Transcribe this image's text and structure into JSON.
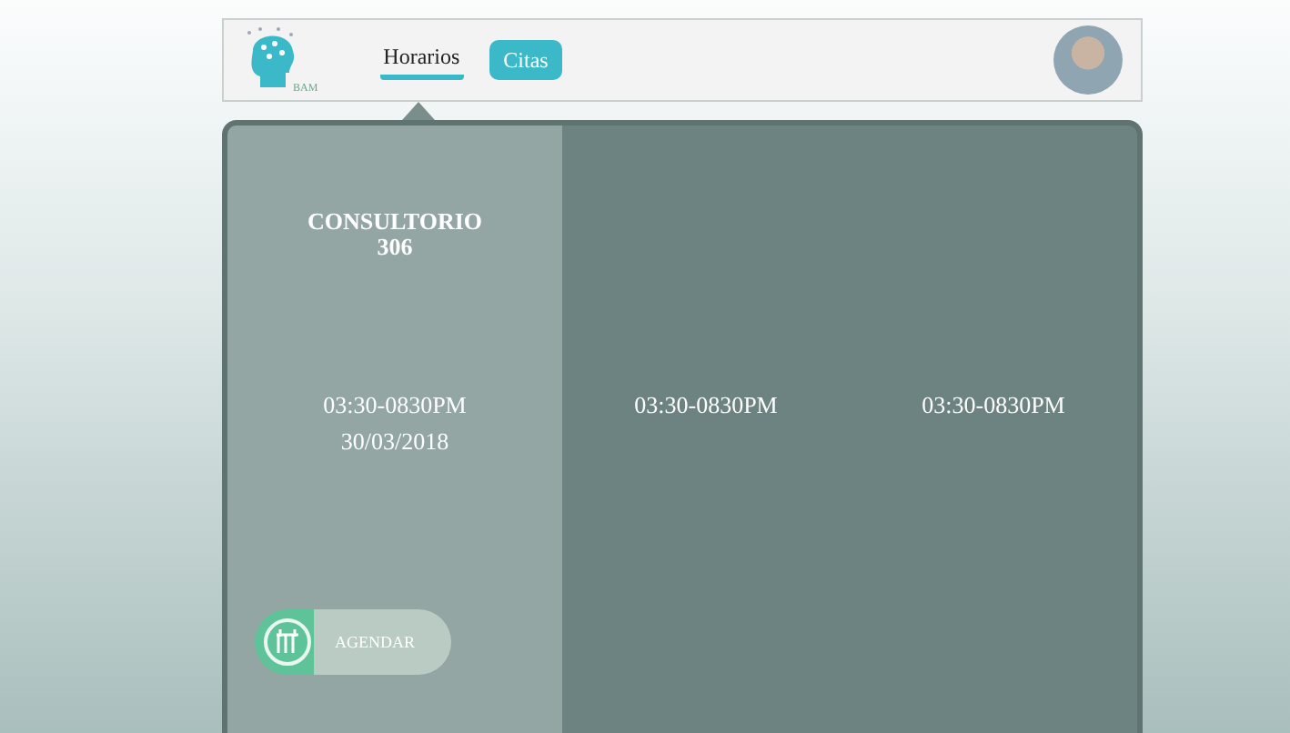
{
  "header": {
    "logo_text": "BAM",
    "tabs": [
      {
        "label": "Horarios",
        "selected": true
      },
      {
        "label": "Citas",
        "selected": false
      }
    ]
  },
  "columns": [
    {
      "selected": true,
      "title": "CONSULTORIO",
      "number": "306",
      "time": "03:30-0830PM",
      "date": "30/03/2018",
      "button": "AGENDAR"
    },
    {
      "selected": false,
      "time": "03:30-0830PM"
    },
    {
      "selected": false,
      "time": "03:30-0830PM"
    }
  ]
}
